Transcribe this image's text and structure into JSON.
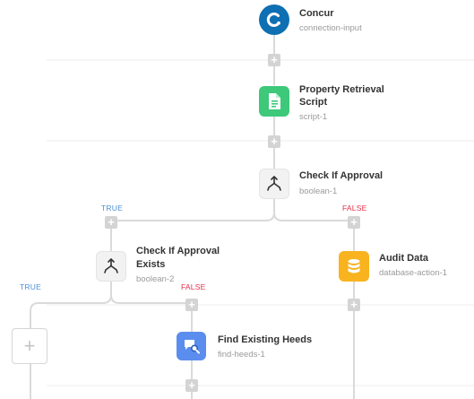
{
  "colors": {
    "line": "#dadada",
    "divider": "#eeeeee",
    "true_label": "#4a8fd6",
    "false_label": "#e5304a",
    "concur": "#0e6fb2",
    "script": "#3dc87a",
    "boolean_bg": "#f2f2f2",
    "database": "#f8b31f",
    "find": "#5b8def"
  },
  "nodes": {
    "concur": {
      "title": "Concur",
      "subtitle": "connection-input",
      "icon": "concur-logo-icon"
    },
    "script": {
      "title_line1": "Property Retrieval",
      "title_line2": "Script",
      "subtitle": "script-1",
      "icon": "document-icon"
    },
    "approval": {
      "title": "Check If Approval",
      "subtitle": "boolean-1",
      "icon": "branch-icon"
    },
    "approval_exists": {
      "title_line1": "Check If Approval",
      "title_line2": "Exists",
      "subtitle": "boolean-2",
      "icon": "branch-icon"
    },
    "audit": {
      "title": "Audit Data",
      "subtitle": "database-action-1",
      "icon": "database-icon"
    },
    "find_heeds": {
      "title": "Find Existing Heeds",
      "subtitle": "find-heeds-1",
      "icon": "search-chat-icon"
    }
  },
  "branches": {
    "true1": "TRUE",
    "false1": "FALSE",
    "true2": "TRUE",
    "false2": "FALSE"
  },
  "add_symbol": "+"
}
